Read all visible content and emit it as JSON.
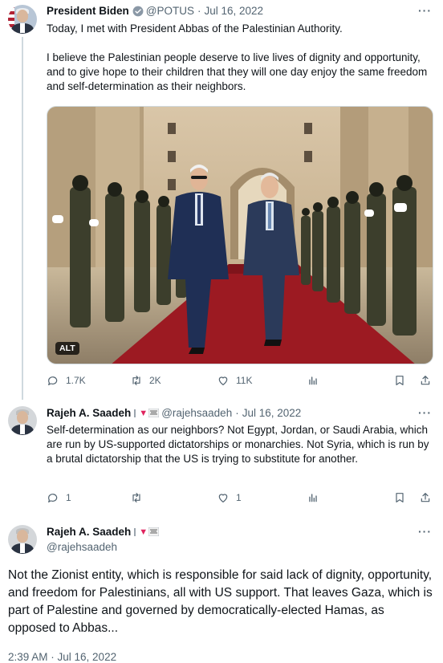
{
  "thread": [
    {
      "author_name": "President Biden",
      "handle": "@POTUS",
      "separator": "·",
      "date": "Jul 16, 2022",
      "more": "···",
      "text": "Today, I met with President Abbas of the Palestinian Authority.\n\nI believe the Palestinian people deserve to live lives of dignity and opportunity, and to give hope to their children that they will one day enjoy the same freedom and self-determination as their neighbors.",
      "photo_alt_badge": "ALT",
      "stats": {
        "replies": "1.7K",
        "retweets": "2K",
        "likes": "11K"
      }
    },
    {
      "author_name": "Rajeh A. Saadeh",
      "handle": "@rajehsaadeh",
      "separator": "·",
      "date": "Jul 16, 2022",
      "more": "···",
      "text": "Self-determination as our neighbors? Not Egypt, Jordan, or Saudi Arabia, which are run by US-supported dictatorships or monarchies. Not Syria, which is run by a brutal dictatorship that the US is trying to substitute for another.",
      "stats": {
        "replies": "1",
        "retweets": "",
        "likes": "1"
      }
    }
  ],
  "main_tweet": {
    "author_name": "Rajeh A. Saadeh",
    "handle": "@rajehsaadeh",
    "more": "···",
    "text": "Not the Zionist entity, which is responsible for said lack of dignity, opportunity, and freedom for Palestinians, all with US support. That leaves Gaza, which is part of Palestine and governed by democratically-elected Hamas, as opposed to Abbas...",
    "timestamp": "2:39 AM · Jul 16, 2022"
  },
  "colors": {
    "text_primary": "#0f1419",
    "text_secondary": "#536471",
    "verified_blue": "#1d9bf0",
    "divider": "#eff3f4",
    "carpet_red": "#9c1a22"
  },
  "icons": {
    "reply": "reply-icon",
    "retweet": "retweet-icon",
    "like": "heart-icon",
    "views": "analytics-icon",
    "bookmark": "bookmark-icon",
    "share": "share-icon"
  }
}
